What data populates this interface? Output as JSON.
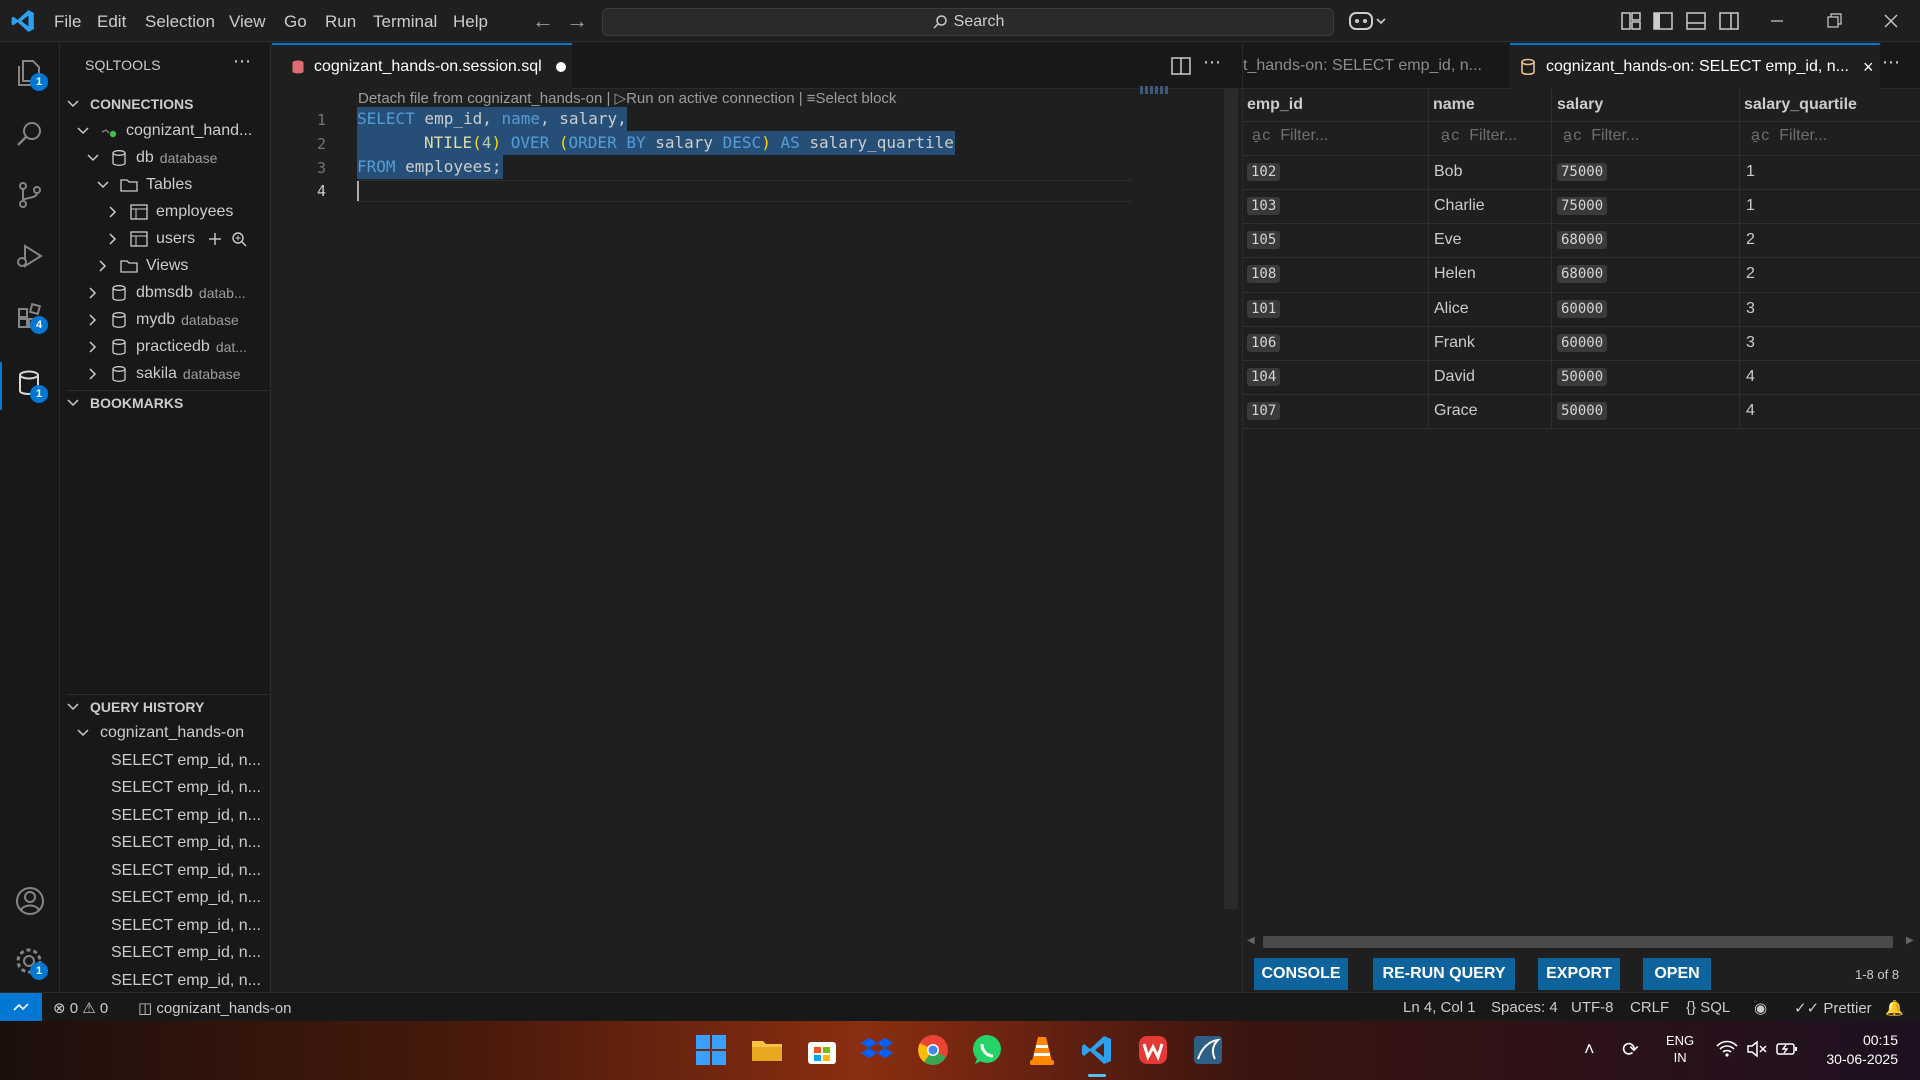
{
  "menu": [
    "File",
    "Edit",
    "Selection",
    "View",
    "Go",
    "Run",
    "Terminal",
    "Help"
  ],
  "search": {
    "label": "Search"
  },
  "activity_badges": {
    "explorer": "1",
    "extensions": "4",
    "sqltools": "1",
    "accounts": "",
    "settings": "1"
  },
  "sidebar": {
    "title": "SQLTOOLS",
    "connections_header": "CONNECTIONS",
    "connection_name": "cognizant_hand...",
    "db_label": "db",
    "db_type": "database",
    "tables_label": "Tables",
    "table_employees": "employees",
    "table_users": "users",
    "views_label": "Views",
    "databases": [
      {
        "name": "dbmsdb",
        "type": "datab..."
      },
      {
        "name": "mydb",
        "type": "database"
      },
      {
        "name": "practicedb",
        "type": "dat..."
      },
      {
        "name": "sakila",
        "type": "database"
      }
    ],
    "bookmarks_header": "BOOKMARKS",
    "history_header": "QUERY HISTORY",
    "history_group": "cognizant_hands-on",
    "history_items": [
      "SELECT emp_id, n...",
      "SELECT emp_id, n...",
      "SELECT emp_id, n...",
      "SELECT emp_id, n...",
      "SELECT emp_id, n...",
      "SELECT emp_id, n...",
      "SELECT emp_id, n...",
      "SELECT emp_id, n...",
      "SELECT emp_id, n..."
    ]
  },
  "editor": {
    "tab_label": "cognizant_hands-on.session.sql",
    "codelens": {
      "detach": "Detach file from cognizant_hands-on |",
      "run": "Run on active connection |",
      "select": "Select block"
    },
    "line_numbers": [
      "1",
      "2",
      "3",
      "4"
    ],
    "code": {
      "l1": {
        "kw": "SELECT",
        "a": " emp_id, ",
        "b": "name",
        "c": ", salary,"
      },
      "l2": {
        "fn": "NTILE",
        "p1": "(",
        "n": "4",
        "p2": ")",
        "kw1": " OVER ",
        "p3": "(",
        "kw2": "ORDER BY",
        "id": " salary ",
        "kw3": "DESC",
        "p4": ")",
        "kw4": " AS ",
        "alias": "salary_quartile"
      },
      "l3": {
        "kw": "FROM",
        "rest": " employees;"
      }
    }
  },
  "results": {
    "tab_inactive": "t_hands-on: SELECT emp_id, n...",
    "tab_active": "cognizant_hands-on: SELECT emp_id, n...",
    "columns": [
      "emp_id",
      "name",
      "salary",
      "salary_quartile"
    ],
    "filter_placeholder": "Filter...",
    "rows": [
      [
        "102",
        "Bob",
        "75000",
        "1"
      ],
      [
        "103",
        "Charlie",
        "75000",
        "1"
      ],
      [
        "105",
        "Eve",
        "68000",
        "2"
      ],
      [
        "108",
        "Helen",
        "68000",
        "2"
      ],
      [
        "101",
        "Alice",
        "60000",
        "3"
      ],
      [
        "106",
        "Frank",
        "60000",
        "3"
      ],
      [
        "104",
        "David",
        "50000",
        "4"
      ],
      [
        "107",
        "Grace",
        "50000",
        "4"
      ]
    ],
    "buttons": {
      "console": "CONSOLE",
      "rerun": "RE-RUN QUERY",
      "export": "EXPORT",
      "open": "OPEN"
    },
    "count": "1-8 of 8"
  },
  "statusbar": {
    "errors": "0",
    "warnings": "0",
    "connection": "cognizant_hands-on",
    "position": "Ln 4, Col 1",
    "spaces": "Spaces: 4",
    "encoding": "UTF-8",
    "eol": "CRLF",
    "language": "SQL",
    "formatter": "Prettier"
  },
  "taskbar": {
    "lang_top": "ENG",
    "lang_bottom": "IN",
    "time": "00:15",
    "date": "30-06-2025"
  },
  "colors": {
    "accent": "#0078d4",
    "button": "#0e639c",
    "keyword": "#569cd6",
    "function": "#dcdcaa"
  }
}
